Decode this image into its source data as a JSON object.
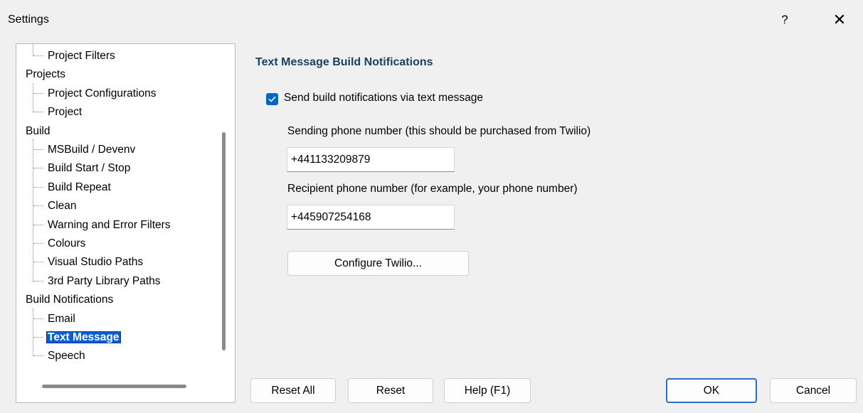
{
  "window": {
    "title": "Settings",
    "help_label": "?",
    "close_label": "✕"
  },
  "tree": {
    "items": [
      {
        "label": "Project Filters",
        "level": 1
      },
      {
        "label": "Projects",
        "level": 0
      },
      {
        "label": "Project Configurations",
        "level": 1
      },
      {
        "label": "Project",
        "level": 1
      },
      {
        "label": "Build",
        "level": 0
      },
      {
        "label": "MSBuild / Devenv",
        "level": 1
      },
      {
        "label": "Build Start / Stop",
        "level": 1
      },
      {
        "label": "Build Repeat",
        "level": 1
      },
      {
        "label": "Clean",
        "level": 1
      },
      {
        "label": "Warning and Error Filters",
        "level": 1
      },
      {
        "label": "Colours",
        "level": 1
      },
      {
        "label": "Visual Studio Paths",
        "level": 1
      },
      {
        "label": "3rd Party Library Paths",
        "level": 1
      },
      {
        "label": "Build Notifications",
        "level": 0
      },
      {
        "label": "Email",
        "level": 1
      },
      {
        "label": "Text Message",
        "level": 1,
        "selected": true
      },
      {
        "label": "Speech",
        "level": 1
      }
    ]
  },
  "content": {
    "heading": "Text Message Build Notifications",
    "send_checkbox": {
      "label": "Send build notifications via text message",
      "checked": true
    },
    "sending_label": "Sending phone number (this should be purchased from Twilio)",
    "sending_value": "+441133209879",
    "recipient_label": "Recipient phone number (for example, your phone number)",
    "recipient_value": "+445907254168",
    "configure_label": "Configure Twilio..."
  },
  "footer": {
    "reset_all": "Reset All",
    "reset": "Reset",
    "help": "Help (F1)",
    "ok": "OK",
    "cancel": "Cancel"
  },
  "colors": {
    "accent": "#0067c0",
    "heading": "#1c3f66",
    "selection": "#0a5ed0"
  }
}
